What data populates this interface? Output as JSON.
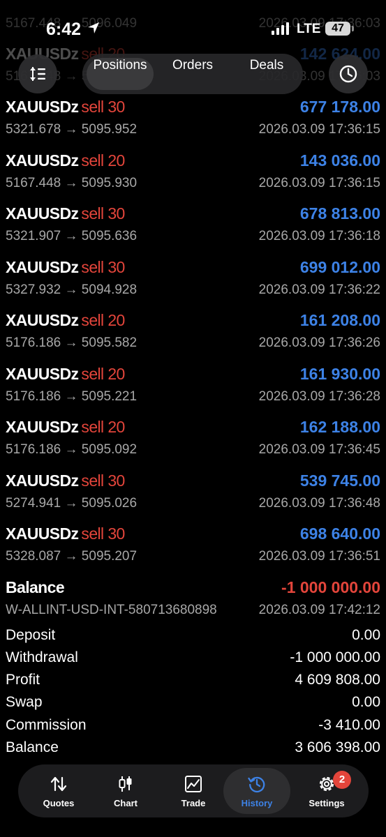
{
  "status_bar": {
    "time": "6:42",
    "network": "LTE",
    "battery": "47"
  },
  "toolbar": {
    "tabs": [
      {
        "label": "Positions",
        "active": true
      },
      {
        "label": "Orders",
        "active": false
      },
      {
        "label": "Deals",
        "active": false
      }
    ],
    "sort_icon": "sort-arrows-icon",
    "period_icon": "clock-icon"
  },
  "partial_rows": [
    {
      "prices": "5167.448 → 5096.049",
      "time": "2026.03.09 17:36:03"
    },
    {
      "symbol": "XAUUSDz",
      "side": "sell 20",
      "profit": "142 624.00",
      "prices": "5167.448 → 5096.061",
      "time": "2026.03.09 17:36:03"
    }
  ],
  "deals": [
    {
      "symbol": "XAUUSDz",
      "side": "sell 30",
      "profit": "677 178.00",
      "prices": "5321.678 → 5095.952",
      "time": "2026.03.09 17:36:15"
    },
    {
      "symbol": "XAUUSDz",
      "side": "sell 20",
      "profit": "143 036.00",
      "prices": "5167.448 → 5095.930",
      "time": "2026.03.09 17:36:15"
    },
    {
      "symbol": "XAUUSDz",
      "side": "sell 30",
      "profit": "678 813.00",
      "prices": "5321.907 → 5095.636",
      "time": "2026.03.09 17:36:18"
    },
    {
      "symbol": "XAUUSDz",
      "side": "sell 30",
      "profit": "699 012.00",
      "prices": "5327.932 → 5094.928",
      "time": "2026.03.09 17:36:22"
    },
    {
      "symbol": "XAUUSDz",
      "side": "sell 20",
      "profit": "161 208.00",
      "prices": "5176.186 → 5095.582",
      "time": "2026.03.09 17:36:26"
    },
    {
      "symbol": "XAUUSDz",
      "side": "sell 20",
      "profit": "161 930.00",
      "prices": "5176.186 → 5095.221",
      "time": "2026.03.09 17:36:28"
    },
    {
      "symbol": "XAUUSDz",
      "side": "sell 20",
      "profit": "162 188.00",
      "prices": "5176.186 → 5095.092",
      "time": "2026.03.09 17:36:45"
    },
    {
      "symbol": "XAUUSDz",
      "side": "sell 30",
      "profit": "539 745.00",
      "prices": "5274.941 → 5095.026",
      "time": "2026.03.09 17:36:48"
    },
    {
      "symbol": "XAUUSDz",
      "side": "sell 30",
      "profit": "698 640.00",
      "prices": "5328.087 → 5095.207",
      "time": "2026.03.09 17:36:51"
    }
  ],
  "balance_op": {
    "title": "Balance",
    "amount": "-1 000 000.00",
    "comment": "W-ALLINT-USD-INT-580713680898",
    "time": "2026.03.09 17:42:12"
  },
  "summary": [
    {
      "label": "Deposit",
      "value": "0.00"
    },
    {
      "label": "Withdrawal",
      "value": "-1 000 000.00"
    },
    {
      "label": "Profit",
      "value": "4 609 808.00"
    },
    {
      "label": "Swap",
      "value": "0.00"
    },
    {
      "label": "Commission",
      "value": "-3 410.00"
    },
    {
      "label": "Balance",
      "value": "3 606 398.00"
    }
  ],
  "nav": [
    {
      "label": "Quotes",
      "icon": "quotes-arrows-icon",
      "active": false
    },
    {
      "label": "Chart",
      "icon": "candlestick-chart-icon",
      "active": false
    },
    {
      "label": "Trade",
      "icon": "trade-chart-icon",
      "active": false
    },
    {
      "label": "History",
      "icon": "history-clock-icon",
      "active": true
    },
    {
      "label": "Settings",
      "icon": "settings-gear-icon",
      "active": false
    }
  ],
  "settings_badge": "2",
  "colors": {
    "sell": "#e3453b",
    "profit_positive": "#3d82e6",
    "negative": "#e3453b",
    "active_tab": "#3d82e6"
  }
}
